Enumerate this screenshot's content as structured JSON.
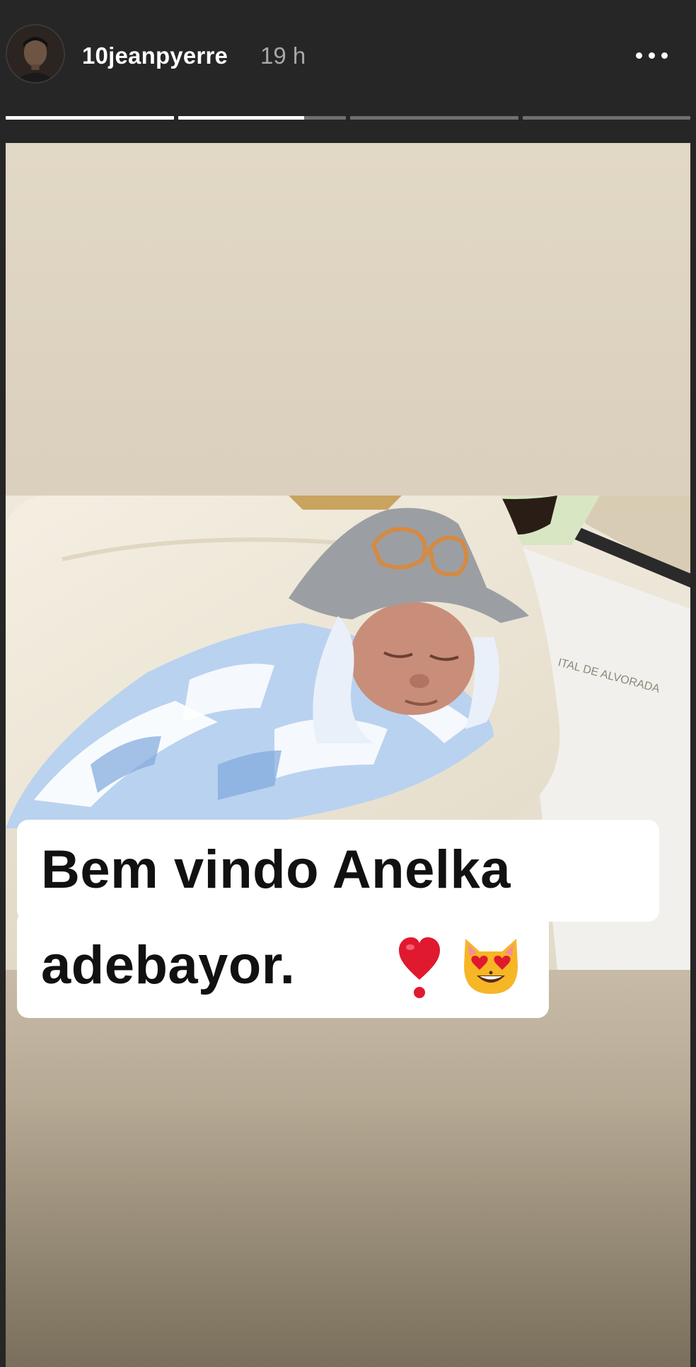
{
  "header": {
    "username": "10jeanpyerre",
    "timestamp": "19 h",
    "avatar_icon": "profile-avatar",
    "more_icon": "more-options-icon"
  },
  "progress": [
    {
      "fill": 1.0
    },
    {
      "fill": 0.75
    },
    {
      "fill": 0.0
    },
    {
      "fill": 0.0
    }
  ],
  "caption": {
    "line1": "Bem vindo Anelka",
    "line2": "adebayor.",
    "emoji1": "heavy-heart-exclamation",
    "emoji2": "smiling-cat-heart-eyes"
  },
  "colors": {
    "background": "#262626",
    "progress_active": "#ffffff",
    "progress_inactive": "#707070",
    "caption_bg": "#ffffff",
    "caption_text": "#111111"
  }
}
